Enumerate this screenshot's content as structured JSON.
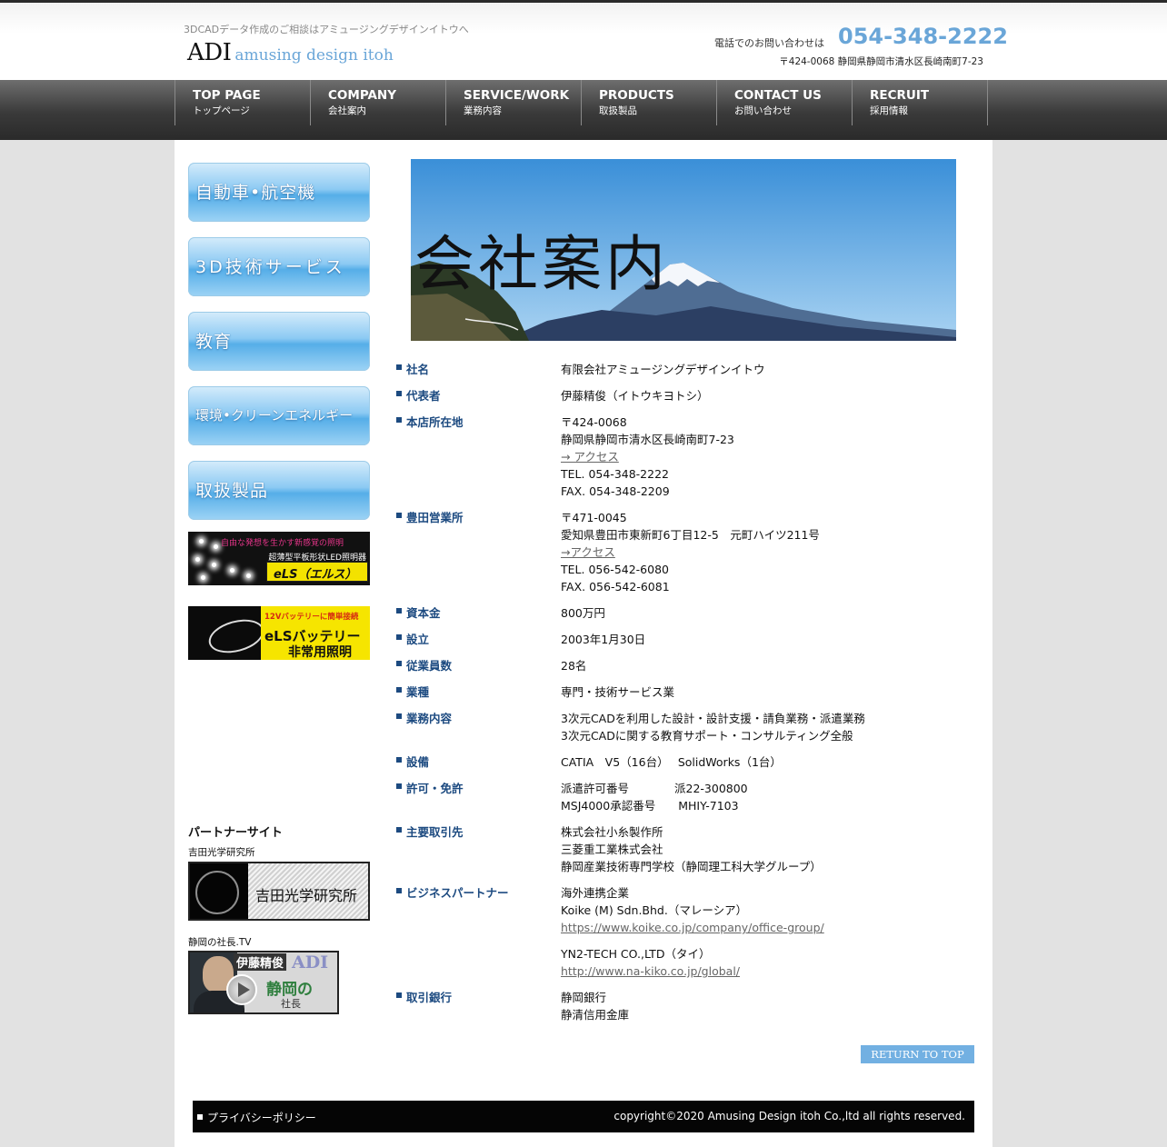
{
  "header": {
    "tagline": "3DCADデータ作成のご相談はアミュージングデザインイトウへ",
    "logo_main": "ADI",
    "logo_sub": "amusing design itoh",
    "phone_label": "電話でのお問い合わせは",
    "phone": "054-348-2222",
    "address": "〒424-0068 静岡県静岡市清水区長崎南町7-23"
  },
  "nav": [
    {
      "en": "TOP PAGE",
      "jp": "トップページ"
    },
    {
      "en": "COMPANY",
      "jp": "会社案内"
    },
    {
      "en": "SERVICE/WORK",
      "jp": "業務内容"
    },
    {
      "en": "PRODUCTS",
      "jp": "取扱製品"
    },
    {
      "en": "CONTACT US",
      "jp": "お問い合わせ"
    },
    {
      "en": "RECRUIT",
      "jp": "採用情報"
    }
  ],
  "sidebar": {
    "buttons": [
      "自動車•航空機",
      "3D技術サービス",
      "教育",
      "環境•クリーンエネルギー",
      "取扱製品"
    ],
    "banner1": {
      "top": "自由な発想を生かす新感覚の照明",
      "mid": "超薄型平板形状LED照明器",
      "box": "eLS（エルス）"
    },
    "banner2": {
      "top": "12Vバッテリーに簡単接続",
      "mid": "eLSバッテリー",
      "bot": "非常用照明"
    },
    "partner_heading": "パートナーサイト",
    "partner1_label": "吉田光学研究所",
    "partner1_text": "吉田光学研究所",
    "partner2_label": "静岡の社長.TV",
    "partner2": {
      "name": "伊藤精俊",
      "adi": "ADI",
      "shizuoka": "静岡の",
      "shacho": "社長"
    }
  },
  "hero": {
    "title": "会社案内"
  },
  "company": {
    "rows": [
      {
        "label": "社名",
        "lines": [
          "有限会社アミュージングデザインイトウ"
        ]
      },
      {
        "label": "代表者",
        "lines": [
          "伊藤精俊（イトウキヨトシ）"
        ]
      },
      {
        "label": "本店所在地",
        "lines": [
          "〒424-0068",
          "静岡県静岡市清水区長崎南町7-23"
        ],
        "link": "→ アクセス",
        "after": [
          "TEL. 054-348-2222",
          "FAX. 054-348-2209"
        ]
      },
      {
        "label": "豊田営業所",
        "lines": [
          "〒471-0045",
          "愛知県豊田市東新町6丁目12-5　元町ハイツ211号"
        ],
        "link": "→アクセス",
        "after": [
          "TEL. 056-542-6080",
          "FAX. 056-542-6081"
        ]
      },
      {
        "label": "資本金",
        "lines": [
          "800万円"
        ]
      },
      {
        "label": "設立",
        "lines": [
          "2003年1月30日"
        ]
      },
      {
        "label": "従業員数",
        "lines": [
          "28名"
        ]
      },
      {
        "label": "業種",
        "lines": [
          "専門・技術サービス業"
        ]
      },
      {
        "label": "業務内容",
        "lines": [
          "3次元CADを利用した設計・設計支援・請負業務・派遣業務",
          "3次元CADに関する教育サポート・コンサルティング全般"
        ]
      },
      {
        "label": "設備",
        "lines": [
          "CATIA　V5（16台）　 SolidWorks（1台）"
        ]
      },
      {
        "label": "許可・免許",
        "lines": [
          "派遣許可番号　　　　派22-300800",
          "MSJ4000承認番号　　MHIY-7103"
        ]
      },
      {
        "label": "主要取引先",
        "lines": [
          "株式会社小糸製作所",
          "三菱重工業株式会社",
          "静岡産業技術専門学校（静岡理工科大学グループ）"
        ]
      },
      {
        "label": "ビジネスパートナー",
        "lines": [
          "海外連携企業",
          "Koike (M) Sdn.Bhd.（マレーシア）"
        ],
        "link": "https://www.koike.co.jp/company/office-group/",
        "after2": [
          "YN2-TECH CO.,LTD（タイ）"
        ],
        "link2": "http://www.na-kiko.co.jp/global/"
      },
      {
        "label": "取引銀行",
        "lines": [
          "静岡銀行",
          "静清信用金庫"
        ]
      }
    ]
  },
  "return_to_top": "RETURN TO TOP",
  "footer": {
    "privacy": "プライバシーポリシー",
    "copyright": "copyright©2020 Amusing Design itoh Co.,ltd all rights reserved."
  }
}
